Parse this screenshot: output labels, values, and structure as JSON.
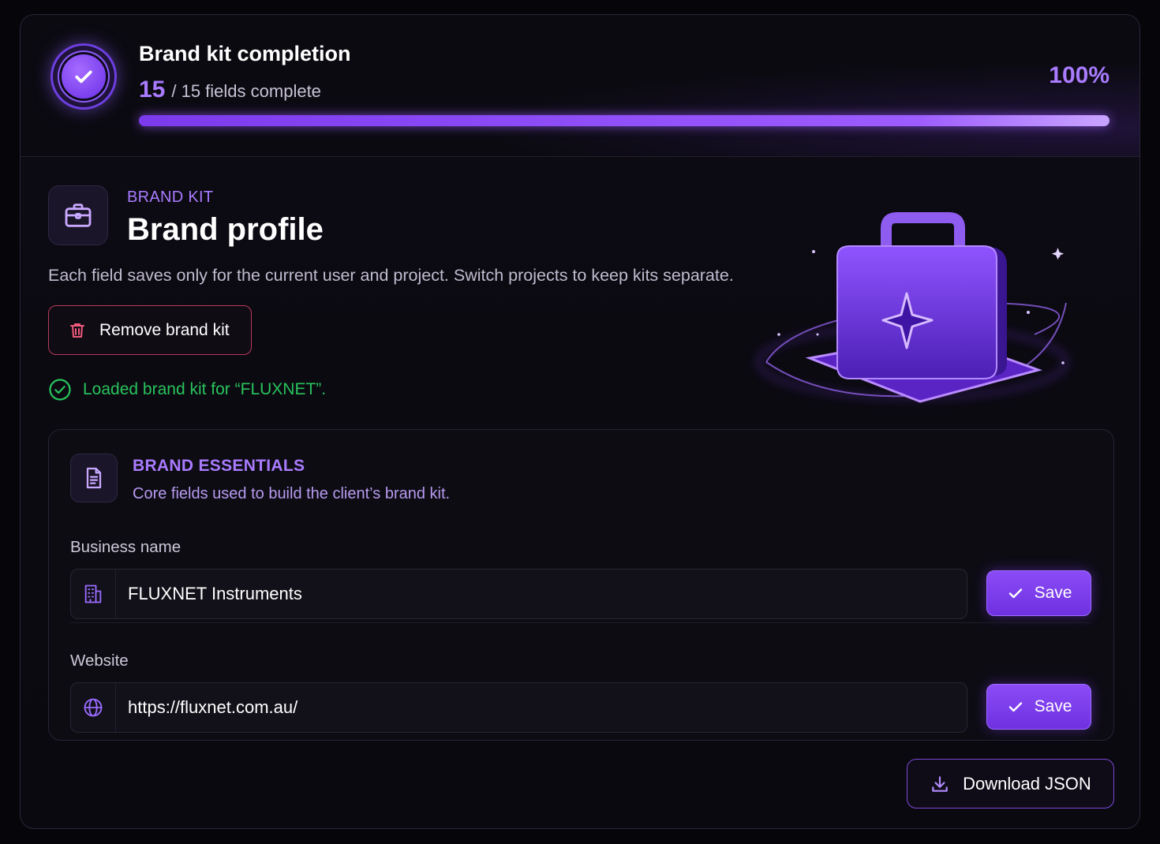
{
  "completion": {
    "title": "Brand kit completion",
    "completed": "15",
    "total_text": "/ 15 fields complete",
    "percent_label": "100%",
    "progress_fraction": 1.0
  },
  "profile": {
    "eyebrow": "BRAND KIT",
    "title": "Brand profile",
    "description": "Each field saves only for the current user and project. Switch projects to keep kits separate.",
    "remove_label": "Remove brand kit",
    "status_text": "Loaded brand kit for “FLUXNET”."
  },
  "essentials": {
    "title": "BRAND ESSENTIALS",
    "subtitle": "Core fields used to build the client’s brand kit.",
    "fields": [
      {
        "label": "Business name",
        "value": "FLUXNET Instruments",
        "icon": "building-icon",
        "save_label": "Save"
      },
      {
        "label": "Website",
        "value": "https://fluxnet.com.au/",
        "icon": "globe-icon",
        "save_label": "Save"
      }
    ]
  },
  "footer": {
    "download_label": "Download JSON"
  },
  "colors": {
    "accent": "#8b5cf6",
    "success": "#29c35c",
    "danger": "#e0456b"
  }
}
